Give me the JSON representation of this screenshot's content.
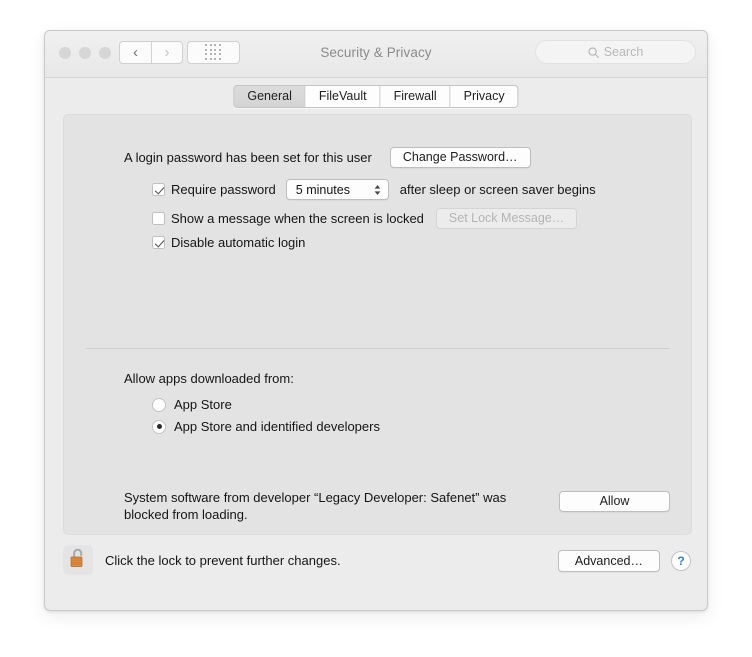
{
  "window": {
    "title": "Security & Privacy",
    "traffic_lights": [
      "close-button",
      "minimize-button",
      "zoom-button"
    ],
    "nav": {
      "back": "‹",
      "forward": "›",
      "show_all": "grid-icon"
    },
    "search": {
      "placeholder": "Search",
      "value": "",
      "icon": "search-icon"
    }
  },
  "tabs": [
    {
      "label": "General",
      "active": true
    },
    {
      "label": "FileVault",
      "active": false
    },
    {
      "label": "Firewall",
      "active": false
    },
    {
      "label": "Privacy",
      "active": false
    }
  ],
  "general": {
    "login_password_text": "A login password has been set for this user",
    "change_password_label": "Change Password…",
    "require_password": {
      "label": "Require password",
      "checked": true,
      "interval_value": "5 minutes",
      "suffix": "after sleep or screen saver begins"
    },
    "lock_message": {
      "label": "Show a message when the screen is locked",
      "checked": false,
      "button_label": "Set Lock Message…",
      "button_disabled": true
    },
    "disable_auto_login": {
      "label": "Disable automatic login",
      "checked": true
    },
    "allow_apps": {
      "heading": "Allow apps downloaded from:",
      "options": [
        {
          "label": "App Store",
          "selected": false
        },
        {
          "label": "App Store and identified developers",
          "selected": true
        }
      ]
    },
    "blocked_software": {
      "message_line1": "System software from developer “Legacy Developer: Safenet” was",
      "message_line2": "blocked from loading.",
      "button_label": "Allow"
    }
  },
  "footer": {
    "lock_icon": "unlocked-padlock-icon",
    "lock_text": "Click the lock to prevent further changes.",
    "advanced_label": "Advanced…",
    "help_label": "?"
  },
  "colors": {
    "window_bg": "#ececec",
    "panel_bg": "#e3e3e3",
    "accent_help": "#2f7fd8",
    "lock_body": "#e08a3c",
    "title_text": "#8b8b8b"
  }
}
